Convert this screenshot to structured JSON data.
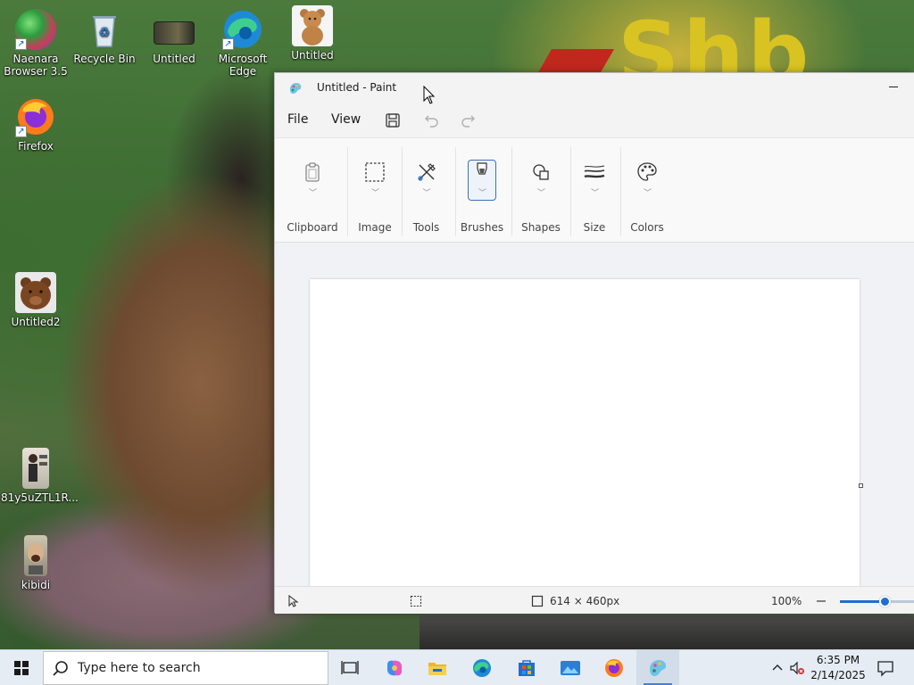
{
  "desktop": {
    "wallpaper_text": "Shb",
    "icons": [
      {
        "id": "naenara",
        "label": "Naenara Browser 3.5"
      },
      {
        "id": "recycle",
        "label": "Recycle Bin"
      },
      {
        "id": "untitled-folder",
        "label": "Untitled"
      },
      {
        "id": "edge",
        "label": "Microsoft Edge"
      },
      {
        "id": "untitled-bear",
        "label": "Untitled"
      },
      {
        "id": "firefox",
        "label": "Firefox"
      },
      {
        "id": "untitled2",
        "label": "Untitled2"
      },
      {
        "id": "81y5",
        "label": "81y5uZTL1R..."
      },
      {
        "id": "kibidi",
        "label": "kibidi"
      }
    ]
  },
  "paint": {
    "title": "Untitled - Paint",
    "menu": {
      "file": "File",
      "view": "View"
    },
    "ribbon": [
      {
        "label": "Clipboard",
        "icon": "clipboard-icon"
      },
      {
        "label": "Image",
        "icon": "selection-icon"
      },
      {
        "label": "Tools",
        "icon": "tools-icon"
      },
      {
        "label": "Brushes",
        "icon": "brush-icon",
        "selected": true
      },
      {
        "label": "Shapes",
        "icon": "shapes-icon"
      },
      {
        "label": "Size",
        "icon": "size-icon"
      },
      {
        "label": "Colors",
        "icon": "palette-icon"
      }
    ],
    "status": {
      "canvas_size": "614 × 460px",
      "zoom": "100%",
      "zoom_fraction": 0.6
    }
  },
  "taskbar": {
    "search_placeholder": "Type here to search",
    "time": "6:35 PM",
    "date": "2/14/2025"
  },
  "colors": {
    "accent": "#1f6fd1",
    "selection_border": "#3b6fb6"
  }
}
